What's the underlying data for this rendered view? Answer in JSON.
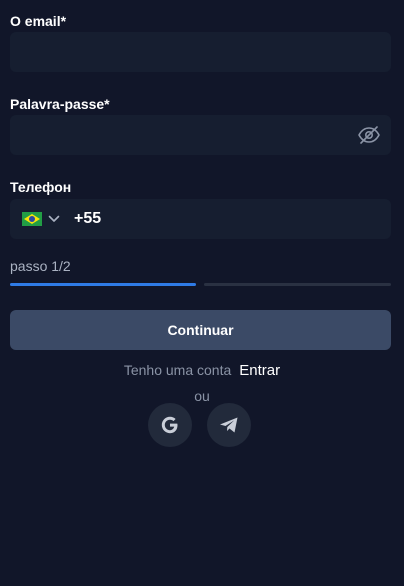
{
  "form": {
    "email": {
      "label": "O email*",
      "value": "",
      "placeholder": ""
    },
    "password": {
      "label": "Palavra-passe*",
      "value": "",
      "placeholder": ""
    },
    "phone": {
      "label": "Телефон",
      "country_flag": "brazil-flag-icon",
      "code": "+55"
    },
    "step": {
      "label": "passo 1/2",
      "current": 1,
      "total": 2
    },
    "submit_label": "Continuar"
  },
  "account": {
    "text": "Tenho uma conta",
    "login_label": "Entrar"
  },
  "divider_text": "ou",
  "social": [
    {
      "name": "google",
      "icon": "google-icon"
    },
    {
      "name": "telegram",
      "icon": "telegram-icon"
    }
  ],
  "colors": {
    "background": "#111629",
    "field": "#161e30",
    "button": "#3b4a66",
    "progress_active": "#2f7be5",
    "progress_inactive": "#2a3142"
  }
}
